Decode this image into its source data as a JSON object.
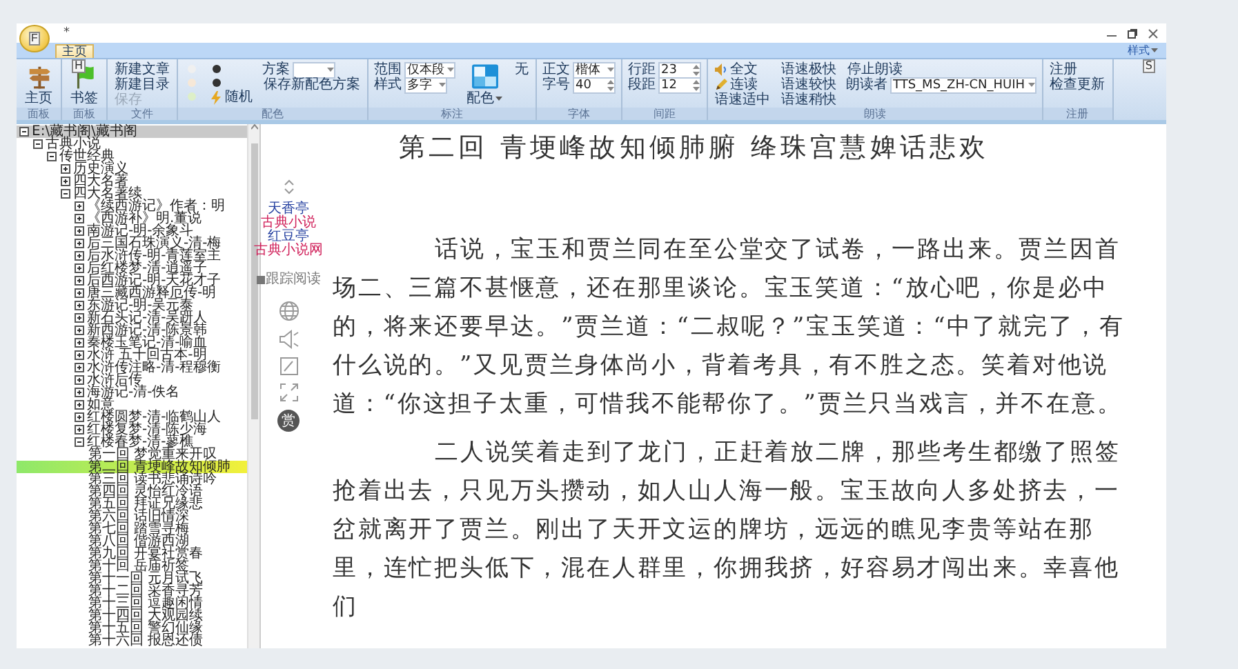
{
  "window": {
    "title": "*",
    "app_key_tip": "F"
  },
  "ribbon": {
    "tabs": [
      {
        "label": "主页",
        "selected": true,
        "key_tip": "H"
      }
    ],
    "style_menu": {
      "label": "样式",
      "key_tip": "S"
    },
    "groups": [
      {
        "label": "面板",
        "columns": [
          [
            {
              "kind": "home",
              "label": "主页"
            }
          ]
        ]
      },
      {
        "label": "面板",
        "columns": [
          [
            {
              "kind": "bookmark",
              "label": "书签"
            }
          ]
        ]
      },
      {
        "label": "文件",
        "columns": [
          [
            {
              "kind": "button",
              "label": "新建文章",
              "disabled": false
            },
            {
              "kind": "button",
              "label": "新建目录",
              "disabled": false
            },
            {
              "kind": "button",
              "label": "保存",
              "disabled": true
            }
          ]
        ]
      },
      {
        "label": "配色",
        "columns": [
          [
            {
              "kind": "swatch",
              "color": "#f0f0f0"
            },
            {
              "kind": "swatch",
              "color": "#f6e8d8"
            },
            {
              "kind": "swatch",
              "color": "#ddefc8"
            }
          ],
          [
            {
              "kind": "swatch",
              "color": "#333333"
            },
            {
              "kind": "swatch",
              "color": "#333333"
            },
            {
              "kind": "random",
              "label": "随机"
            }
          ],
          [
            {
              "kind": "dropdown",
              "label": "方案"
            },
            {
              "kind": "button",
              "label": "保存新配色方案"
            }
          ]
        ]
      },
      {
        "label": "标注",
        "columns": [
          [
            {
              "kind": "dropdown",
              "label": "范围",
              "value": "仅本段"
            },
            {
              "kind": "dropdown",
              "label": "样式",
              "value": "多字"
            }
          ],
          [
            {
              "kind": "palette",
              "label": "配色"
            }
          ],
          [
            {
              "kind": "button",
              "label": "无"
            }
          ]
        ]
      },
      {
        "label": "字体",
        "columns": [
          [
            {
              "kind": "dropdown",
              "label": "正文",
              "value": "楷体"
            },
            {
              "kind": "spinner",
              "label": "字号",
              "value": "40"
            }
          ]
        ]
      },
      {
        "label": "间距",
        "columns": [
          [
            {
              "kind": "spinner",
              "label": "行距",
              "value": "23"
            },
            {
              "kind": "spinner",
              "label": "段距",
              "value": "12"
            }
          ]
        ]
      },
      {
        "label": "朗读",
        "columns": [
          [
            {
              "kind": "read_all",
              "label": "全文"
            },
            {
              "kind": "read_on",
              "label": "连读"
            },
            {
              "kind": "button",
              "label": "语速适中"
            }
          ],
          [
            {
              "kind": "button",
              "label": "语速极快"
            },
            {
              "kind": "button",
              "label": "语速较快"
            },
            {
              "kind": "button",
              "label": "语速稍快"
            }
          ],
          [
            {
              "kind": "button",
              "label": "停止朗读"
            },
            {
              "kind": "dropdown",
              "label": "朗读者",
              "value": "TTS_MS_ZH-CN_HUIH"
            }
          ]
        ]
      },
      {
        "label": "注册",
        "columns": [
          [
            {
              "kind": "button",
              "label": "注册"
            },
            {
              "kind": "button",
              "label": "检查更新"
            }
          ]
        ]
      }
    ]
  },
  "tree": {
    "items": [
      {
        "label": "E:\\藏书阁\\藏书阁",
        "expanded": true,
        "children": [
          {
            "label": "古典小说",
            "expanded": true,
            "children": [
              {
                "label": "传世经典",
                "expanded": true,
                "children": [
                  {
                    "label": "历史演义",
                    "expanded": false
                  },
                  {
                    "label": "四大名著",
                    "expanded": false
                  },
                  {
                    "label": "四大名著续",
                    "expanded": true,
                    "children": [
                      {
                        "label": "《续西游记》作者：明",
                        "expanded": false
                      },
                      {
                        "label": "《西游补》明.董说",
                        "expanded": false
                      },
                      {
                        "label": "南游记-明-余象斗",
                        "expanded": false
                      },
                      {
                        "label": "后三国石珠演义-清-梅",
                        "expanded": false
                      },
                      {
                        "label": "后水浒传-明-青莲室主",
                        "expanded": false
                      },
                      {
                        "label": "后红楼梦-清-逍遥子",
                        "expanded": false
                      },
                      {
                        "label": "后西游记-明-天花才子",
                        "expanded": false
                      },
                      {
                        "label": "唐三藏西游释厄传-明",
                        "expanded": false
                      },
                      {
                        "label": "东游记-明-吴元泰",
                        "expanded": false
                      },
                      {
                        "label": "新石头记-清-吴趼人",
                        "expanded": false
                      },
                      {
                        "label": "新西游记-清-陈景韩",
                        "expanded": false
                      },
                      {
                        "label": "秦楼玉笔记-清-喻血",
                        "expanded": false
                      },
                      {
                        "label": "水浒 五十回古本-明",
                        "expanded": false
                      },
                      {
                        "label": "水浒传注略-清-程穆衡",
                        "expanded": false
                      },
                      {
                        "label": "水浒后传",
                        "expanded": false
                      },
                      {
                        "label": "海游记-清-佚名",
                        "expanded": false
                      },
                      {
                        "label": "如意",
                        "expanded": false
                      },
                      {
                        "label": "红楼圆梦-清-临鹤山人",
                        "expanded": false
                      },
                      {
                        "label": "红楼复梦-清-陈少海",
                        "expanded": false
                      },
                      {
                        "label": "红楼春梦-清-蓼樵",
                        "expanded": true,
                        "children": [
                          {
                            "label": "第一回 梦觉重来开叹",
                            "selected": false
                          },
                          {
                            "label": "第二回 青埂峰故知倾肺",
                            "selected": true
                          },
                          {
                            "label": "第三回 读书悲诵诗吟",
                            "selected": false
                          },
                          {
                            "label": "第四回 灵怡红冷语",
                            "selected": false
                          },
                          {
                            "label": "第五回 拜证兄缘悲",
                            "selected": false
                          },
                          {
                            "label": "第六回 话旧情深",
                            "selected": false
                          },
                          {
                            "label": "第七回 踏雪寻梅",
                            "selected": false
                          },
                          {
                            "label": "第八回 偕游西湖",
                            "selected": false
                          },
                          {
                            "label": "第九回 开宴社赏春",
                            "selected": false
                          },
                          {
                            "label": "第十回 岳庙祈签",
                            "selected": false
                          },
                          {
                            "label": "第十一回 元月试飞",
                            "selected": false
                          },
                          {
                            "label": "第十二回 采香寻芳",
                            "selected": false
                          },
                          {
                            "label": "第十三回 逗趣闲情",
                            "selected": false
                          },
                          {
                            "label": "第十四回 大观园续",
                            "selected": false
                          },
                          {
                            "label": "第十五回 警幻仙缘",
                            "selected": false
                          },
                          {
                            "label": "第十六回 报恩还债",
                            "selected": false
                          }
                        ]
                      }
                    ]
                  }
                ]
              }
            ]
          }
        ]
      }
    ]
  },
  "side": {
    "logo": [
      "天香亭",
      "古典小说",
      "红豆亭",
      "古典小说网"
    ],
    "follow": "跟踪阅读",
    "reward": "赏"
  },
  "reader": {
    "title": "第二回 青埂峰故知倾肺腑 绛珠宫慧婢话悲欢",
    "paragraphs": [
      "话说，宝玉和贾兰同在至公堂交了试卷，一路出来。贾兰因首场二、三篇不甚惬意，还在那里谈论。宝玉笑道：“放心吧，你是必中的，将来还要早达。”贾兰道：“二叔呢？”宝玉笑道：“中了就完了，有什么说的。”又见贾兰身体尚小，背着考具，有不胜之态。笑着对他说道：“你这担子太重，可惜我不能帮你了。”贾兰只当戏言，并不在意。",
      "二人说笑着走到了龙门，正赶着放二牌，那些考生都缴了照签抢着出去，只见万头攒动，如人山人海一般。宝玉故向人多处挤去，一岔就离开了贾兰。刚出了天开文运的牌坊，远远的瞧见李贵等站在那里，连忙把头低下，混在人群里，你拥我挤，好容易才闯出来。幸喜他们"
    ]
  }
}
